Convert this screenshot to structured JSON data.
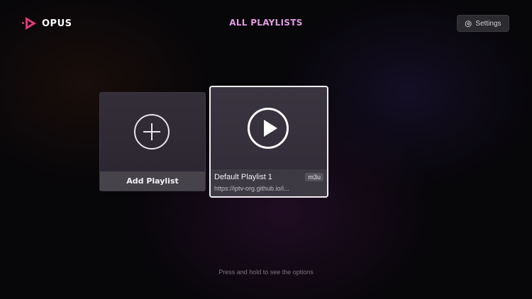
{
  "app": {
    "name": "OPUS",
    "brand_color": "#e2397a"
  },
  "header": {
    "title": "ALL PLAYLISTS",
    "title_color": "#e29be0",
    "settings_label": "Settings",
    "settings_icon": "gear-icon"
  },
  "cards": {
    "add": {
      "label": "Add Playlist",
      "icon": "plus-circle-icon"
    },
    "playlists": [
      {
        "name": "Default Playlist 1",
        "url": "https://iptv-org.github.io/i...",
        "type_badge": "m3u",
        "icon": "play-circle-icon",
        "focused": true
      }
    ]
  },
  "footer": {
    "hint": "Press and hold to see the options"
  }
}
